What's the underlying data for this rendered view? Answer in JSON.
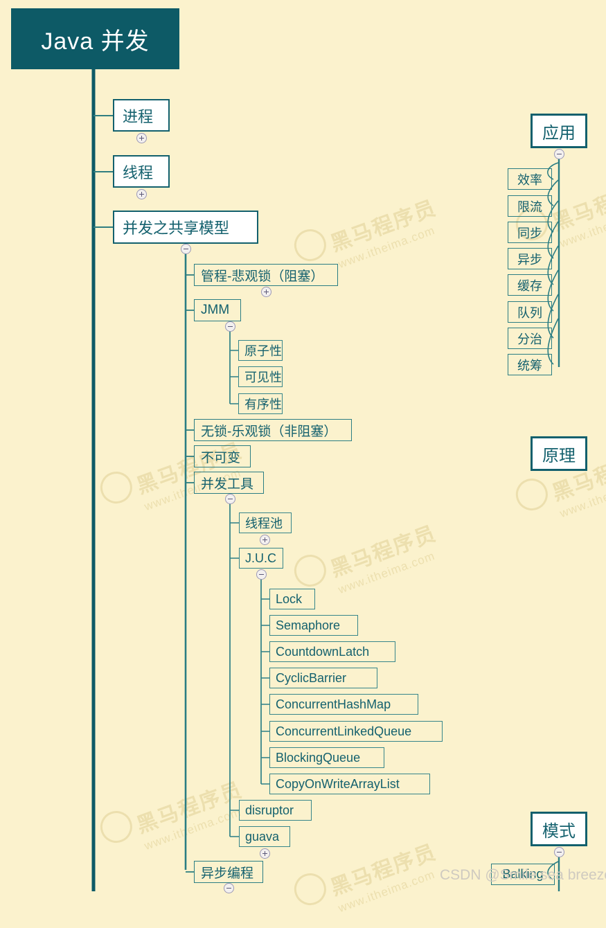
{
  "page": {
    "background_color": "#fbf2cd",
    "accent_color": "#0d5a66",
    "border_color": "#12606d",
    "text_color": "#14616e",
    "root_text_color": "#ffffff"
  },
  "background_watermark": {
    "primary": "黑马程序员",
    "secondary": "www.itheima.com"
  },
  "footer_watermark": "CSDN @Smile sea breeze",
  "mindmap": {
    "root": {
      "label": "Java 并发"
    },
    "branches": [
      {
        "id": "process",
        "label": "进程",
        "toggle": "plus"
      },
      {
        "id": "thread",
        "label": "线程",
        "toggle": "plus"
      },
      {
        "id": "shared",
        "label": "并发之共享模型",
        "toggle": "minus",
        "children": [
          {
            "id": "monitor",
            "label": "管程-悲观锁（阻塞）",
            "toggle": "plus"
          },
          {
            "id": "jmm",
            "label": "JMM",
            "toggle": "minus",
            "children": [
              {
                "id": "atomicity",
                "label": "原子性"
              },
              {
                "id": "visibility",
                "label": "可见性"
              },
              {
                "id": "ordering",
                "label": "有序性"
              }
            ]
          },
          {
            "id": "lockfree",
            "label": "无锁-乐观锁（非阻塞）"
          },
          {
            "id": "immutable",
            "label": "不可变"
          },
          {
            "id": "tools",
            "label": "并发工具",
            "toggle": "minus",
            "children": [
              {
                "id": "threadpool",
                "label": "线程池",
                "toggle": "plus"
              },
              {
                "id": "juc",
                "label": "J.U.C",
                "toggle": "minus",
                "children": [
                  {
                    "id": "lock",
                    "label": "Lock"
                  },
                  {
                    "id": "semaphore",
                    "label": "Semaphore"
                  },
                  {
                    "id": "cdl",
                    "label": "CountdownLatch"
                  },
                  {
                    "id": "cb",
                    "label": "CyclicBarrier"
                  },
                  {
                    "id": "chm",
                    "label": "ConcurrentHashMap"
                  },
                  {
                    "id": "clq",
                    "label": "ConcurrentLinkedQueue"
                  },
                  {
                    "id": "bq",
                    "label": "BlockingQueue"
                  },
                  {
                    "id": "cowal",
                    "label": "CopyOnWriteArrayList"
                  }
                ]
              },
              {
                "id": "disruptor",
                "label": "disruptor"
              },
              {
                "id": "guava",
                "label": "guava",
                "toggle": "plus"
              }
            ]
          },
          {
            "id": "async",
            "label": "异步编程",
            "toggle": "minus"
          }
        ]
      }
    ],
    "right_column": [
      {
        "id": "application",
        "label": "应用",
        "toggle": "minus",
        "children": [
          {
            "id": "efficiency",
            "label": "效率"
          },
          {
            "id": "ratelimit",
            "label": "限流"
          },
          {
            "id": "sync",
            "label": "同步"
          },
          {
            "id": "async_r",
            "label": "异步"
          },
          {
            "id": "cache",
            "label": "缓存"
          },
          {
            "id": "queue",
            "label": "队列"
          },
          {
            "id": "divide",
            "label": "分治"
          },
          {
            "id": "planning",
            "label": "统筹"
          }
        ]
      },
      {
        "id": "principle",
        "label": "原理"
      },
      {
        "id": "pattern",
        "label": "模式",
        "toggle": "minus",
        "children": [
          {
            "id": "balking",
            "label": "Balking"
          }
        ]
      }
    ]
  }
}
